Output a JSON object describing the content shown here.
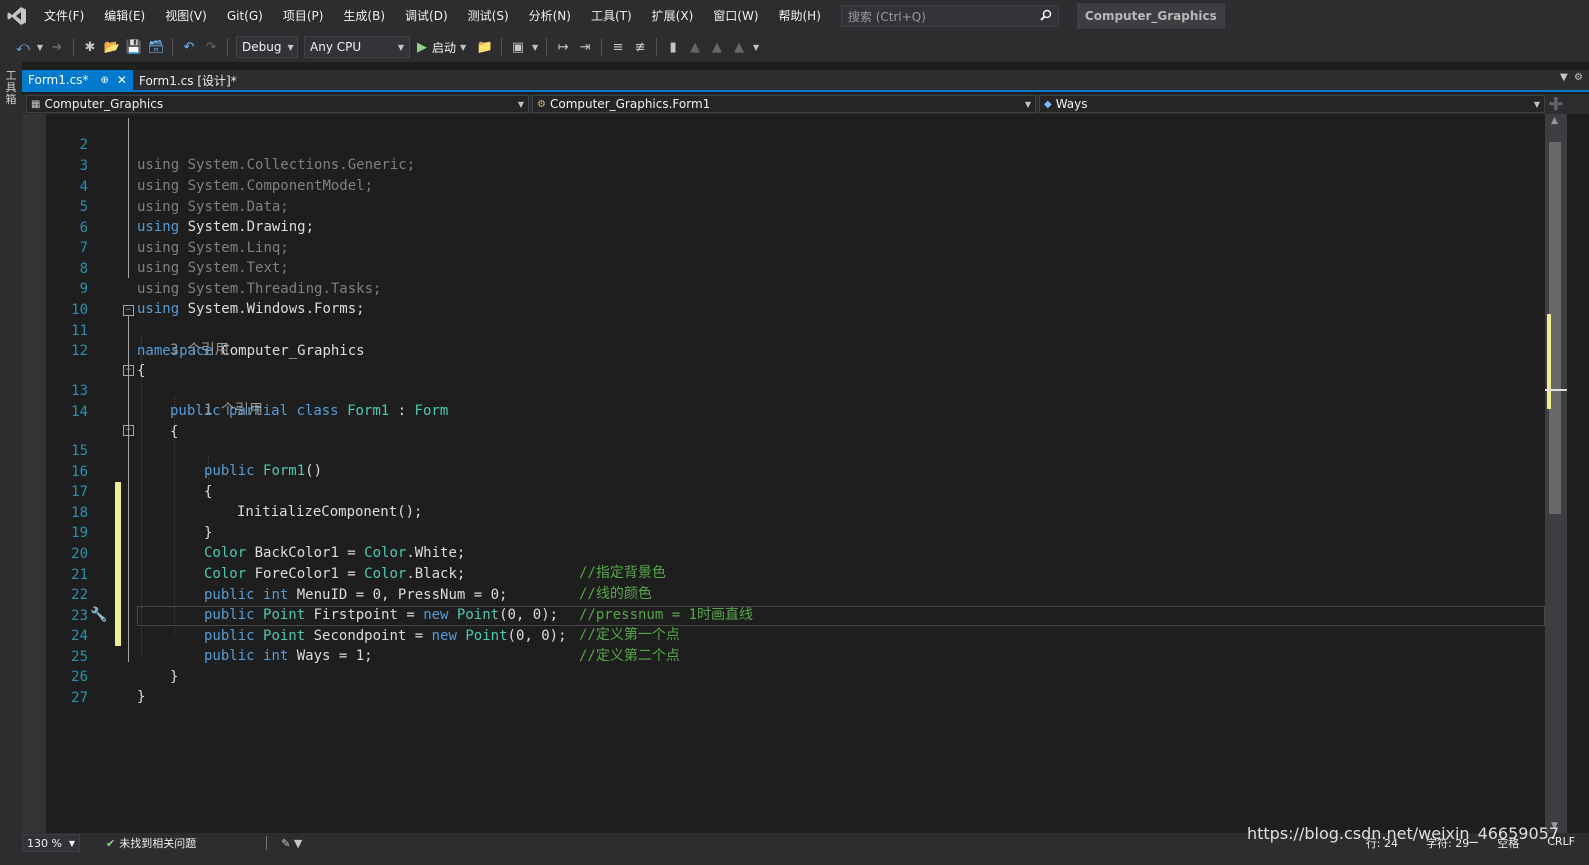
{
  "menubar": {
    "items": [
      "文件(F)",
      "编辑(E)",
      "视图(V)",
      "Git(G)",
      "项目(P)",
      "生成(B)",
      "调试(D)",
      "测试(S)",
      "分析(N)",
      "工具(T)",
      "扩展(X)",
      "窗口(W)",
      "帮助(H)"
    ],
    "search_placeholder": "搜索 (Ctrl+Q)",
    "project_title": "Computer_Graphics"
  },
  "toolbar": {
    "configuration": "Debug",
    "platform": "Any CPU",
    "start_label": "启动"
  },
  "left_strip": {
    "toolbox_label": "工具箱"
  },
  "tabs": [
    {
      "label": "Form1.cs*",
      "active": true
    },
    {
      "label": "Form1.cs [设计]*",
      "active": false
    }
  ],
  "navbar": {
    "project": "Computer_Graphics",
    "class": "Computer_Graphics.Form1",
    "member": "Ways"
  },
  "code": {
    "line_numbers": [
      "2",
      "3",
      "4",
      "5",
      "6",
      "7",
      "8",
      "9",
      "10",
      "11",
      "12",
      "13",
      "14",
      "15",
      "16",
      "17",
      "18",
      "19",
      "20",
      "21",
      "22",
      "23",
      "24",
      "25",
      "26",
      "27"
    ],
    "lines": {
      "l2": "System.Collections.Generic;",
      "l3": "System.ComponentModel;",
      "l4": "System.Data;",
      "l5": "System.Drawing;",
      "l6": "System.Linq;",
      "l7": "System.Text;",
      "l8": "System.Threading.Tasks;",
      "l9": "System.Windows.Forms;",
      "kw_using": "using",
      "kw_namespace": "namespace",
      "ns_name": "Computer_Graphics",
      "brace_open": "{",
      "brace_close": "}",
      "lens_class": "3 个引用",
      "kw_public": "public",
      "kw_partial": "partial",
      "kw_class": "class",
      "class_name": "Form1",
      "colon": ":",
      "base_class": "Form",
      "lens_ctor": "1 个引用",
      "ctor_name": "Form1",
      "ctor_parens": "()",
      "init_call": "InitializeComponent();",
      "l19_type": "Color",
      "l19_body": "BackColor1 = ",
      "l19_val_type": "Color",
      "l19_val": ".White;",
      "l19_comment": "//指定背景色",
      "l20_type": "Color",
      "l20_body": "ForeColor1 = ",
      "l20_val_type": "Color",
      "l20_val": ".Black;",
      "l20_comment": "//线的颜色",
      "kw_int": "int",
      "l21_body": "MenuID = 0, PressNum = 0;",
      "l21_comment": "//pressnum = 1时画直线",
      "type_point": "Point",
      "l22_body": "Firstpoint = ",
      "kw_new": "new",
      "point_args": "(0, 0);",
      "l22_comment": "//定义第一个点",
      "l23_body": "Secondpoint = ",
      "l23_comment": "//定义第二个点",
      "l24_body": "Ways = 1;"
    }
  },
  "status": {
    "zoom": "130 %",
    "issues": "未找到相关问题",
    "line": "行: 24",
    "char": "字符: 29",
    "spaces": "空格",
    "eol": "CRLF"
  },
  "watermark": "https://blog.csdn.net/weixin_46659057",
  "colors": {
    "accent": "#007acc",
    "keyword": "#569cd6",
    "type": "#4ec9b0",
    "comment": "#57a64a",
    "line_number": "#2b91af",
    "change_marker": "#efef91"
  }
}
